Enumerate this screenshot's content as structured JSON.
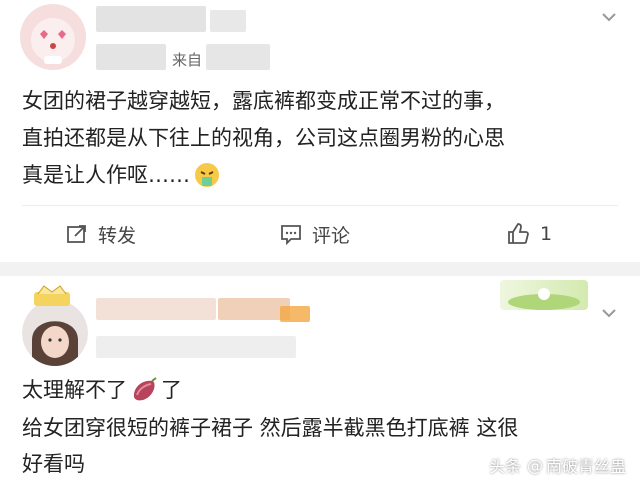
{
  "post1": {
    "source_text": "来自",
    "lines": [
      "女团的裙子越穿越短，露底裤都变成正常不过的事，",
      "直拍还都是从下往上的视角，公司这点圈男粉的心思",
      "真是让人作呕……"
    ],
    "emoji": "vomit-face-icon",
    "actions": {
      "repost": "转发",
      "comment": "评论",
      "like_count": "1"
    }
  },
  "post2": {
    "lines": [
      "太理解不了",
      "了",
      "给女团穿很短的裤子裙子 然后露半截黑色打底裤 这很",
      "好看吗"
    ],
    "emoji": "sweet-potato-icon"
  },
  "watermark": {
    "platform": "头条",
    "handle": "南破青丝蛊"
  },
  "colors": {
    "separator": "#f2f2f2",
    "text": "#222222",
    "icon": "#555555"
  }
}
